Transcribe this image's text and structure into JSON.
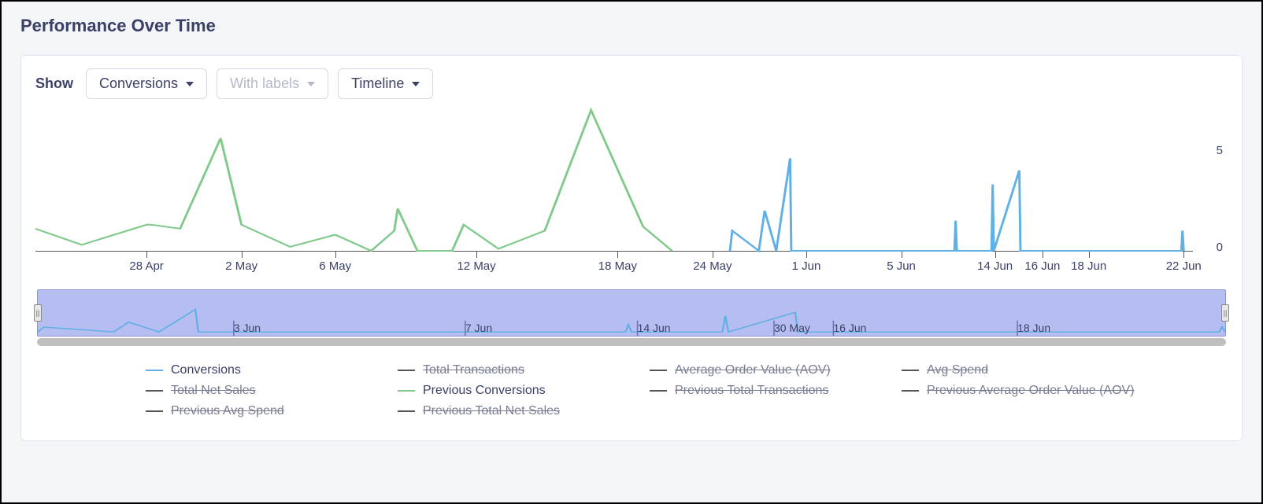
{
  "title": "Performance Over Time",
  "controls": {
    "show_label": "Show",
    "dropdown_metric": "Conversions",
    "dropdown_labels": "With labels",
    "dropdown_mode": "Timeline"
  },
  "chart_data": {
    "type": "line",
    "title": "Performance Over Time",
    "xlabel": "",
    "ylabel": "",
    "ylim": [
      0,
      7
    ],
    "y_ticks": [
      0,
      5
    ],
    "x_tick_labels": [
      "28 Apr",
      "2 May",
      "6 May",
      "12 May",
      "18 May",
      "24 May",
      "1 Jun",
      "5 Jun",
      "14 Jun",
      "16 Jun",
      "18 Jun",
      "22 Jun"
    ],
    "x_tick_positions_pct": [
      9.6,
      17.8,
      25.9,
      38.1,
      50.3,
      58.5,
      66.6,
      74.8,
      82.9,
      87.0,
      91.0,
      99.2
    ],
    "series": [
      {
        "name": "Conversions",
        "color": "#5eb0e5",
        "active": true,
        "points": [
          {
            "x_pct": 60.0,
            "y": 0
          },
          {
            "x_pct": 60.2,
            "y": 1
          },
          {
            "x_pct": 62.5,
            "y": 0
          },
          {
            "x_pct": 63.0,
            "y": 2
          },
          {
            "x_pct": 64.0,
            "y": 0
          },
          {
            "x_pct": 65.2,
            "y": 4.6
          },
          {
            "x_pct": 65.3,
            "y": 0
          },
          {
            "x_pct": 68.5,
            "y": 0
          },
          {
            "x_pct": 70.6,
            "y": 0
          },
          {
            "x_pct": 79.4,
            "y": 0
          },
          {
            "x_pct": 79.5,
            "y": 1.5
          },
          {
            "x_pct": 79.6,
            "y": 0
          },
          {
            "x_pct": 82.6,
            "y": 0
          },
          {
            "x_pct": 82.7,
            "y": 3.3
          },
          {
            "x_pct": 82.8,
            "y": 0
          },
          {
            "x_pct": 85.0,
            "y": 4.0
          },
          {
            "x_pct": 85.1,
            "y": 0
          },
          {
            "x_pct": 99.0,
            "y": 0
          },
          {
            "x_pct": 99.1,
            "y": 1.0
          },
          {
            "x_pct": 99.2,
            "y": 0
          }
        ]
      },
      {
        "name": "Previous Conversions",
        "color": "#7fc98a",
        "active": true,
        "points": [
          {
            "x_pct": 0.0,
            "y": 1.1
          },
          {
            "x_pct": 4.0,
            "y": 0.3
          },
          {
            "x_pct": 9.6,
            "y": 1.3
          },
          {
            "x_pct": 10.0,
            "y": 1.3
          },
          {
            "x_pct": 12.5,
            "y": 1.1
          },
          {
            "x_pct": 16.0,
            "y": 5.6
          },
          {
            "x_pct": 17.8,
            "y": 1.3
          },
          {
            "x_pct": 22.0,
            "y": 0.2
          },
          {
            "x_pct": 25.9,
            "y": 0.8
          },
          {
            "x_pct": 29.0,
            "y": 0.0
          },
          {
            "x_pct": 31.0,
            "y": 1.0
          },
          {
            "x_pct": 31.3,
            "y": 2.1
          },
          {
            "x_pct": 33.0,
            "y": 0.0
          },
          {
            "x_pct": 36.0,
            "y": 0.0
          },
          {
            "x_pct": 37.0,
            "y": 1.3
          },
          {
            "x_pct": 40.0,
            "y": 0.1
          },
          {
            "x_pct": 44.0,
            "y": 1.0
          },
          {
            "x_pct": 48.0,
            "y": 7.0
          },
          {
            "x_pct": 52.5,
            "y": 1.2
          },
          {
            "x_pct": 55.0,
            "y": 0.0
          }
        ]
      }
    ],
    "inactive_series": [
      "Total Transactions",
      "Average Order Value (AOV)",
      "Avg Spend",
      "Total Net Sales",
      "Previous Total Transactions",
      "Previous Average Order Value (AOV)",
      "Previous Avg Spend",
      "Previous Total Net Sales"
    ]
  },
  "navigator": {
    "ticks": [
      {
        "pos_pct": 16.5,
        "label": "3 Jun"
      },
      {
        "pos_pct": 36.0,
        "label": "7 Jun"
      },
      {
        "pos_pct": 50.5,
        "label": "14 Jun"
      },
      {
        "pos_pct": 62.0,
        "label": "30 May"
      },
      {
        "pos_pct": 67.0,
        "label": "16 Jun"
      },
      {
        "pos_pct": 82.5,
        "label": "18 Jun"
      }
    ]
  },
  "legend": [
    {
      "label": "Conversions",
      "color": "#5eb0e5",
      "active": true
    },
    {
      "label": "Total Transactions",
      "color": "#555555",
      "active": false
    },
    {
      "label": "Average Order Value (AOV)",
      "color": "#555555",
      "active": false
    },
    {
      "label": "Avg Spend",
      "color": "#555555",
      "active": false
    },
    {
      "label": "Total Net Sales",
      "color": "#555555",
      "active": false
    },
    {
      "label": "Previous Conversions",
      "color": "#7fc98a",
      "active": true
    },
    {
      "label": "Previous Total Transactions",
      "color": "#555555",
      "active": false
    },
    {
      "label": "Previous Average Order Value (AOV)",
      "color": "#555555",
      "active": false
    },
    {
      "label": "Previous Avg Spend",
      "color": "#555555",
      "active": false
    },
    {
      "label": "Previous Total Net Sales",
      "color": "#555555",
      "active": false
    }
  ]
}
